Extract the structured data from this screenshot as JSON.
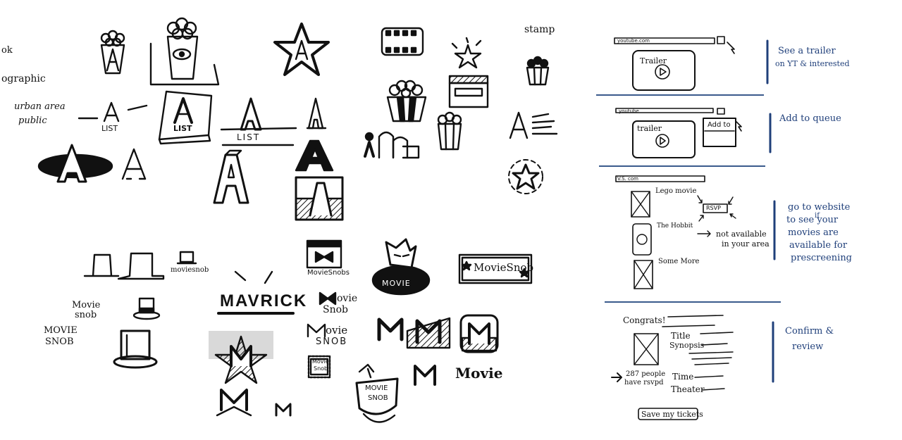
{
  "left_notes": {
    "note1": "ok",
    "note2": "ographic",
    "note3": "urban area",
    "note4": "public",
    "stamp": "stamp"
  },
  "a_logos": {
    "list_small": "LIST",
    "list_banner": "LIST",
    "list_big": "LIST",
    "letter": "A"
  },
  "moviesnob": {
    "hat_small_caption": "moviesnob",
    "movie": "Movie",
    "snob": "snob",
    "movie_caps": "MOVIE",
    "snob_caps": "SNOB",
    "mavrick": "MAVRICK",
    "movie_snobs": "MovieSnobs",
    "ovie": "ovie",
    "snob2": "Snob",
    "ovie2": "ovie",
    "snob3": "SNOB",
    "badge_movie": "Movie",
    "badge_snob": "Snob",
    "ticket": "MovieSnob",
    "oval_label": "MOVIE",
    "shield_movie": "MOVIE",
    "shield_snob": "SNOB",
    "m_letter": "M",
    "wordmark": "Movie"
  },
  "storyboard": {
    "frame1": {
      "url": "youtube.com",
      "video_label": "Trailer",
      "annotation": [
        "See a trailer",
        "on YT & interested"
      ]
    },
    "frame2": {
      "url": "youtube",
      "video_label": "trailer",
      "button": "Add to",
      "annotation": [
        "Add to queue"
      ]
    },
    "frame3": {
      "url": "V.S. com",
      "movie1": "Lego movie",
      "movie2": "The Hobbit",
      "movie3": "Some More",
      "rsvp": "RSVP",
      "note": [
        "not available",
        "in your area"
      ],
      "annotation": [
        "go to website",
        "to see your",
        "movies are",
        "available for",
        "prescreening"
      ],
      "if": "if"
    },
    "frame4": {
      "congrats": "Congrats!",
      "title": "Title",
      "synopsis": "Synopsis",
      "rsvp_count": [
        "287 people",
        "have rsvpd"
      ],
      "time": "Time",
      "theater": "Theater",
      "button": "Save my tickets",
      "annotation": [
        "Confirm &",
        "review"
      ]
    }
  },
  "colors": {
    "ink": "#111111",
    "annotation_blue": "#1f3f7a",
    "divider_blue": "#3a5a8c"
  }
}
